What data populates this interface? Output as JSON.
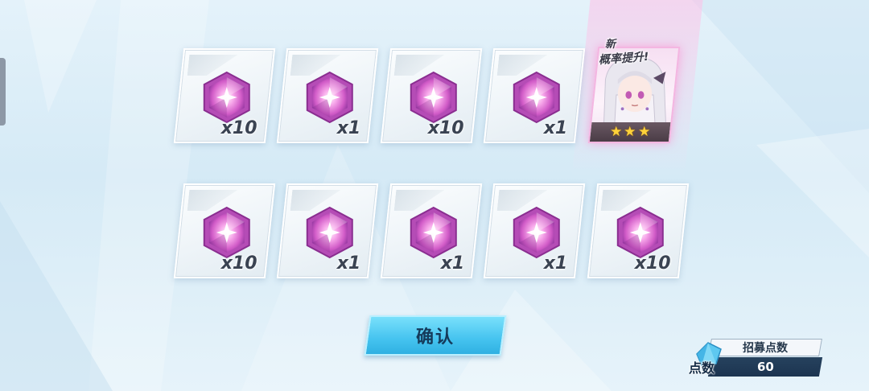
{
  "rewards": [
    {
      "item_icon": "pink-crystal-icon",
      "quantity": "x10"
    },
    {
      "item_icon": "pink-crystal-icon",
      "quantity": "x1"
    },
    {
      "item_icon": "pink-crystal-icon",
      "quantity": "x10"
    },
    {
      "item_icon": "pink-crystal-icon",
      "quantity": "x1"
    },
    {
      "item_icon": "pink-crystal-icon",
      "quantity": "x10"
    },
    {
      "item_icon": "pink-crystal-icon",
      "quantity": "x1"
    },
    {
      "item_icon": "pink-crystal-icon",
      "quantity": "x1"
    },
    {
      "item_icon": "pink-crystal-icon",
      "quantity": "x1"
    },
    {
      "item_icon": "pink-crystal-icon",
      "quantity": "x10"
    }
  ],
  "featured_character": {
    "new_label": "新",
    "rate_up_label": "概率提升!",
    "stars": 3,
    "glow_color": "#f4b6e1"
  },
  "confirm_button": {
    "label": "确认",
    "color": "#45c3ef"
  },
  "recruit_points": {
    "title": "招募点数",
    "short_label": "点数",
    "value": "60"
  }
}
